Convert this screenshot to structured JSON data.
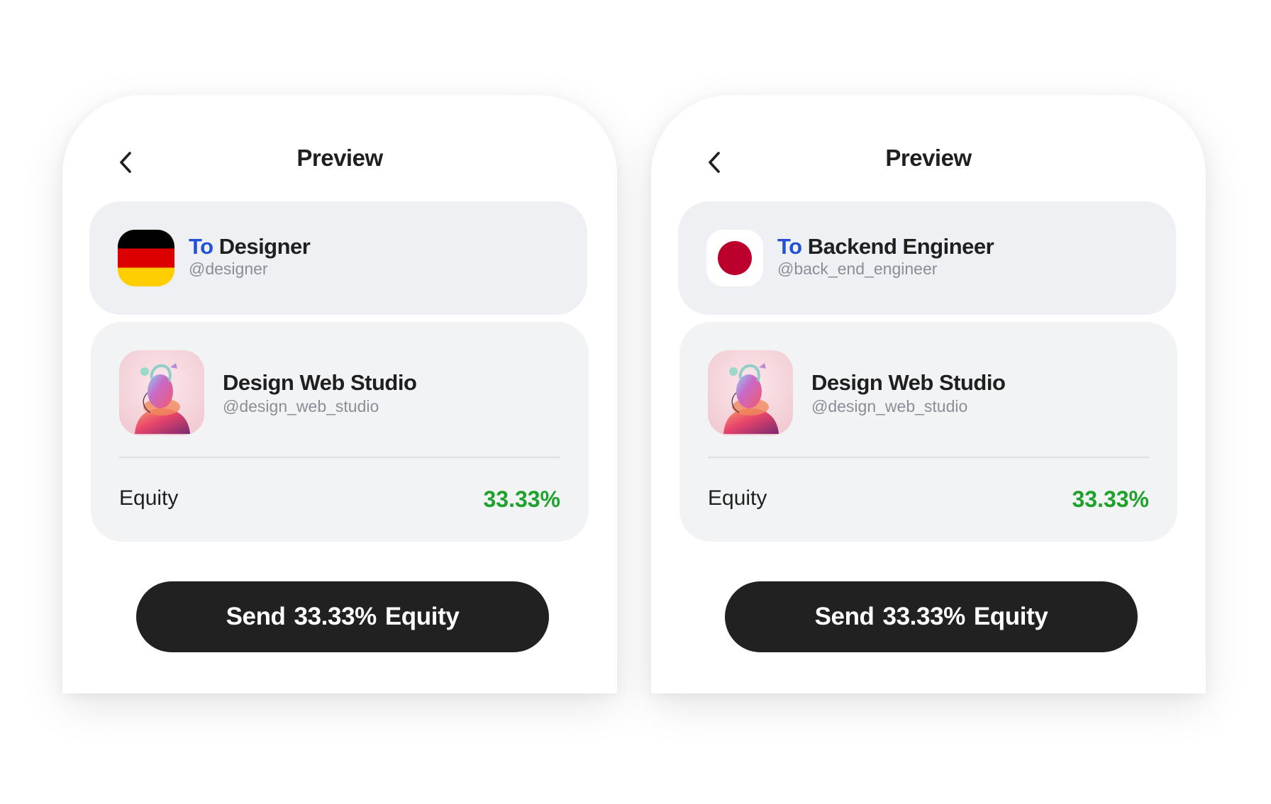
{
  "colors": {
    "accent_blue": "#2250d6",
    "equity_green": "#1fa22b",
    "button_dark": "#212121",
    "card_bg": "#eef0f3"
  },
  "screens": [
    {
      "header": {
        "back_icon": "chevron-left-icon",
        "title": "Preview"
      },
      "recipient": {
        "flag": "germany-flag-icon",
        "to_word": "To",
        "name": "Designer",
        "handle": "@designer"
      },
      "studio": {
        "avatar": "studio-avatar-image",
        "name": "Design Web Studio",
        "handle": "@design_web_studio",
        "equity_label": "Equity",
        "equity_value": "33.33%"
      },
      "send_button": {
        "verb": "Send",
        "amount": "33.33%",
        "noun": "Equity"
      }
    },
    {
      "header": {
        "back_icon": "chevron-left-icon",
        "title": "Preview"
      },
      "recipient": {
        "flag": "japan-flag-icon",
        "to_word": "To",
        "name": "Backend Engineer",
        "handle": "@back_end_engineer"
      },
      "studio": {
        "avatar": "studio-avatar-image",
        "name": "Design Web Studio",
        "handle": "@design_web_studio",
        "equity_label": "Equity",
        "equity_value": "33.33%"
      },
      "send_button": {
        "verb": "Send",
        "amount": "33.33%",
        "noun": "Equity"
      }
    }
  ]
}
